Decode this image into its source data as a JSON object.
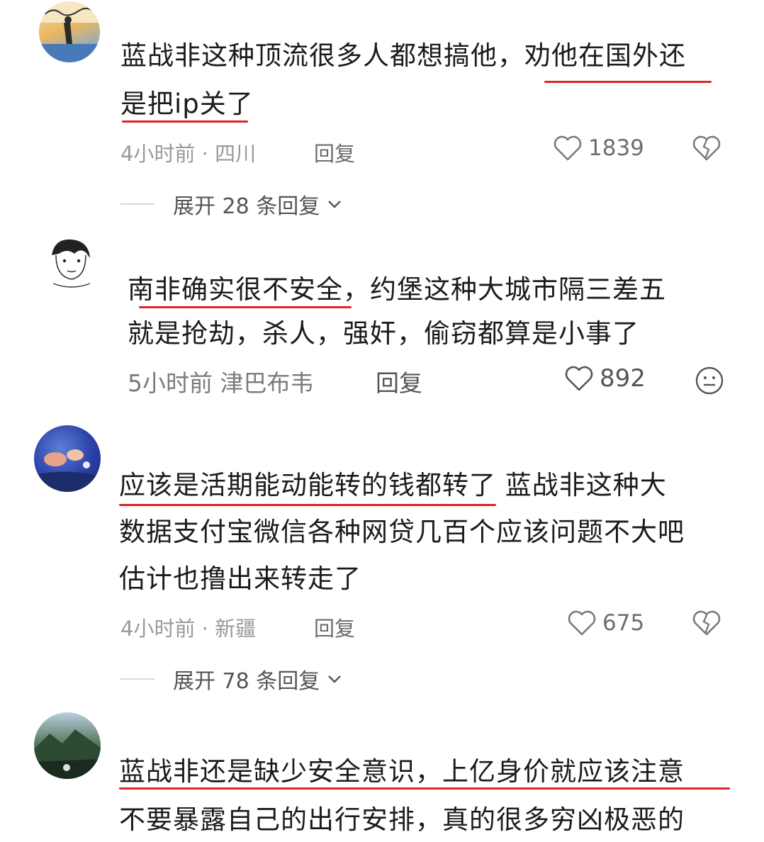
{
  "comments": [
    {
      "lines": [
        "蓝战非这种顶流很多人都想搞他，劝他在国外还",
        "是把ip关了"
      ],
      "meta": "4小时前 · 四川",
      "reply": "回复",
      "likes": "1839",
      "expand": "展开 28 条回复"
    },
    {
      "lines": [
        "南非确实很不安全，约堡这种大城市隔三差五",
        "就是抢劫，杀人，强奸，偷窃都算是小事了"
      ],
      "meta": "5小时前 津巴布韦",
      "reply": "回复",
      "likes": "892"
    },
    {
      "lines": [
        "应该是活期能动能转的钱都转了 蓝战非这种大",
        "数据支付宝微信各种网贷几百个应该问题不大吧",
        "估计也撸出来转走了"
      ],
      "meta": "4小时前 · 新疆",
      "reply": "回复",
      "likes": "675",
      "expand": "展开 78 条回复"
    },
    {
      "lines": [
        "蓝战非还是缺少安全意识，上亿身价就应该注意",
        "不要暴露自己的出行安排，真的很多穷凶极恶的"
      ]
    }
  ],
  "icons": [
    "heart-icon",
    "broken-heart-icon",
    "neutral-face-icon",
    "chevron-down-icon"
  ],
  "colors": {
    "underline": "#d9252b",
    "meta": "#9a9a9a"
  }
}
